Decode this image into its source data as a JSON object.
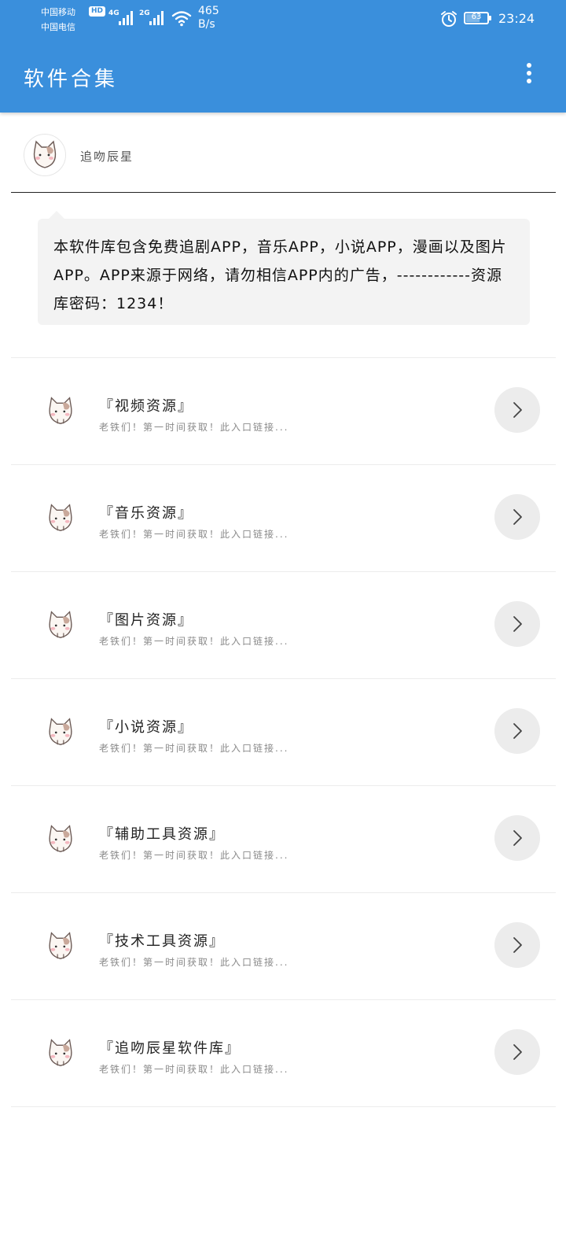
{
  "status_bar": {
    "carrier_1": "中国移动",
    "carrier_2": "中国电信",
    "hd": "HD",
    "net_1": "4G",
    "net_2": "2G",
    "speed_value": "465",
    "speed_unit": "B/s",
    "battery": "63",
    "time": "23:24"
  },
  "app_bar": {
    "title": "软件合集"
  },
  "profile": {
    "name": "追吻辰星"
  },
  "notice": {
    "text": "本软件库包含免费追剧APP，音乐APP，小说APP，漫画以及图片APP。APP来源于网络，请勿相信APP内的广告，------------资源库密码：1234！"
  },
  "list": {
    "items": [
      {
        "title": "『视频资源』",
        "subtitle": "老铁们！第一时间获取！此入口链接..."
      },
      {
        "title": "『音乐资源』",
        "subtitle": "老铁们！第一时间获取！此入口链接..."
      },
      {
        "title": "『图片资源』",
        "subtitle": "老铁们！第一时间获取！此入口链接..."
      },
      {
        "title": "『小说资源』",
        "subtitle": "老铁们！第一时间获取！此入口链接..."
      },
      {
        "title": "『辅助工具资源』",
        "subtitle": "老铁们！第一时间获取！此入口链接..."
      },
      {
        "title": "『技术工具资源』",
        "subtitle": "老铁们！第一时间获取！此入口链接..."
      },
      {
        "title": "『追吻辰星软件库』",
        "subtitle": "老铁们！第一时间获取！此入口链接..."
      }
    ]
  },
  "colors": {
    "app_bar": "#3a8fdc",
    "notice_bg": "#f3f3f3",
    "button_bg": "#ececec"
  },
  "icons": {
    "menu": "more-vertical-icon",
    "row_icon": "cat-sticker-icon",
    "row_action": "chevron-right-icon"
  }
}
